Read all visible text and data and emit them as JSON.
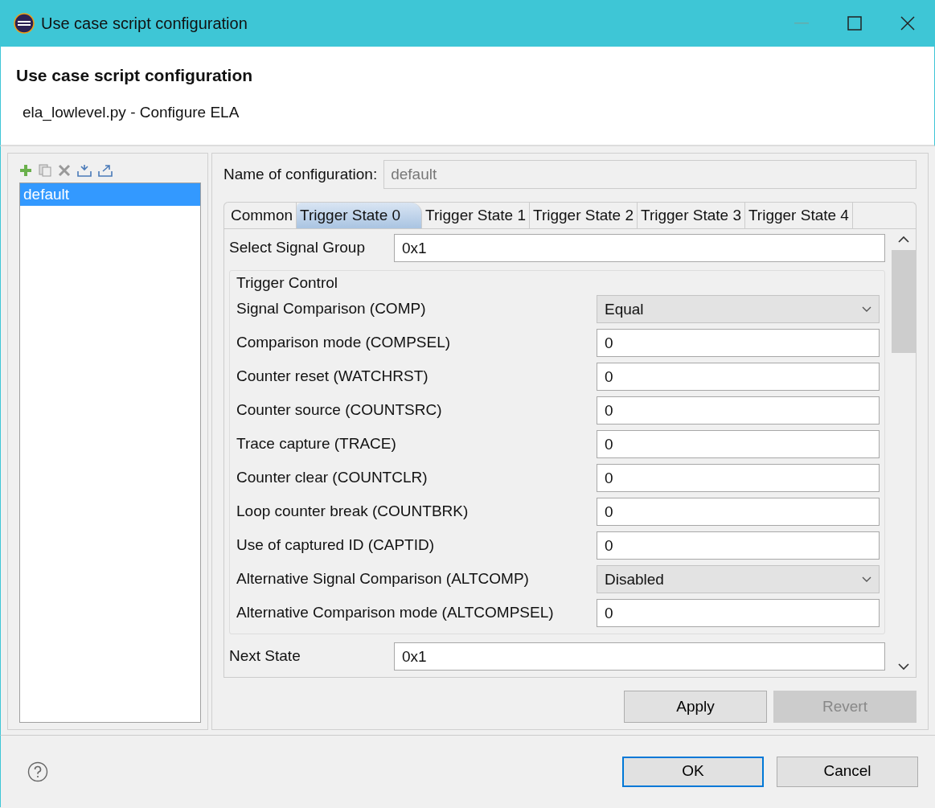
{
  "window": {
    "title": "Use case script configuration"
  },
  "header": {
    "title": "Use case script configuration",
    "subtitle": "ela_lowlevel.py - Configure ELA"
  },
  "configurations": [
    {
      "label": "default",
      "selected": true
    }
  ],
  "name_field": {
    "label": "Name of configuration:",
    "value": "default",
    "disabled": true
  },
  "tabs": [
    {
      "label": "Common",
      "selected": false
    },
    {
      "label": "Trigger State 0",
      "selected": true
    },
    {
      "label": "Trigger State 1",
      "selected": false
    },
    {
      "label": "Trigger State 2",
      "selected": false
    },
    {
      "label": "Trigger State 3",
      "selected": false
    },
    {
      "label": "Trigger State 4",
      "selected": false
    }
  ],
  "select_signal_group": {
    "label": "Select Signal Group",
    "value": "0x1"
  },
  "trigger_control": {
    "title": "Trigger Control",
    "fields": [
      {
        "label": "Signal Comparison (COMP)",
        "kind": "select",
        "value": "Equal"
      },
      {
        "label": "Comparison mode (COMPSEL)",
        "kind": "text",
        "value": "0"
      },
      {
        "label": "Counter reset (WATCHRST)",
        "kind": "text",
        "value": "0"
      },
      {
        "label": "Counter source (COUNTSRC)",
        "kind": "text",
        "value": "0"
      },
      {
        "label": "Trace capture (TRACE)",
        "kind": "text",
        "value": "0"
      },
      {
        "label": "Counter clear (COUNTCLR)",
        "kind": "text",
        "value": "0"
      },
      {
        "label": "Loop counter break (COUNTBRK)",
        "kind": "text",
        "value": "0"
      },
      {
        "label": "Use of captured ID (CAPTID)",
        "kind": "text",
        "value": "0"
      },
      {
        "label": "Alternative Signal Comparison (ALTCOMP)",
        "kind": "select",
        "value": "Disabled"
      },
      {
        "label": "Alternative Comparison mode (ALTCOMPSEL)",
        "kind": "text",
        "value": "0"
      }
    ]
  },
  "next_state": {
    "label": "Next State",
    "value": "0x1"
  },
  "panel_buttons": [
    {
      "label": "Apply",
      "disabled": false
    },
    {
      "label": "Revert",
      "disabled": true
    }
  ],
  "dialog_buttons": [
    {
      "label": "OK",
      "default": true
    },
    {
      "label": "Cancel",
      "default": false
    }
  ]
}
